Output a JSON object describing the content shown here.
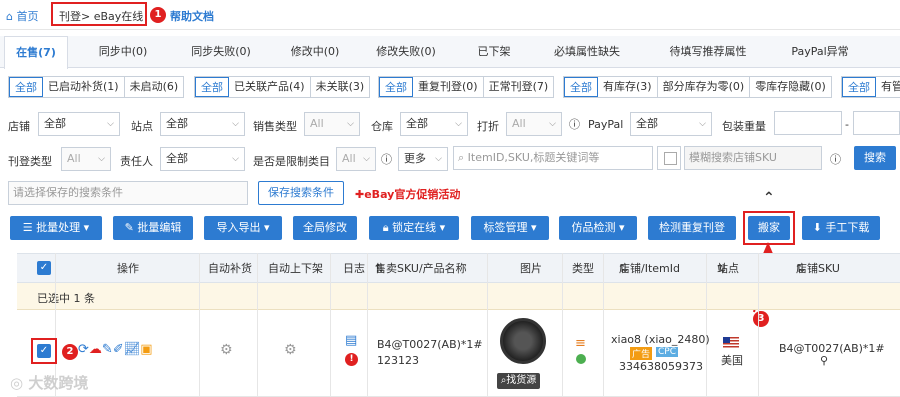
{
  "breadcrumb": {
    "home": "首页",
    "crumb": "刊登> eBay在线",
    "doc": "帮助文档",
    "badge": "1"
  },
  "tabs": [
    "在售(7)",
    "同步中(0)",
    "同步失败(0)",
    "修改中(0)",
    "修改失败(0)",
    "已下架",
    "必填属性缺失",
    "待填写推荐属性",
    "PayPal异常"
  ],
  "filters": {
    "group1": [
      "全部",
      "已启动补货(1)",
      "未启动(6)"
    ],
    "group2": [
      "全部",
      "已关联产品(4)",
      "未关联(3)"
    ],
    "group3": [
      "全部",
      "重复刊登(0)",
      "正常刊登(7)"
    ],
    "group4": [
      "全部",
      "有库存(3)",
      "部分库存为零(0)",
      "零库存隐藏(0)"
    ],
    "group5": [
      "全部",
      "有管"
    ]
  },
  "search": {
    "store_label": "店铺",
    "store_value": "全部",
    "site_label": "站点",
    "site_value": "全部",
    "saletype_label": "销售类型",
    "saletype_value": "All",
    "warehouse_label": "仓库",
    "warehouse_value": "全部",
    "discount_label": "打折",
    "discount_value": "All",
    "paypal_label": "PayPal",
    "paypal_value": "全部",
    "weight_label": "包装重量",
    "dash": "-",
    "listtype_label": "刊登类型",
    "listtype_value": "All",
    "owner_label": "责任人",
    "owner_value": "全部",
    "limited_label": "是否是限制类目",
    "limited_value": "All",
    "more_value": "更多",
    "keyword_placeholder": "ItemID,SKU,标题关键词等",
    "fuzzy_placeholder": "模糊搜索店铺SKU",
    "search_btn": "搜索",
    "saved_placeholder": "请选择保存的搜索条件",
    "save_btn": "保存搜索条件",
    "promo": "eBay官方促销活动"
  },
  "toolbar": [
    "批量处理",
    "批量编辑",
    "导入导出",
    "全局修改",
    "锁定在线",
    "标签管理",
    "仿品检测",
    "检测重复刊登",
    "搬家",
    "手工下载"
  ],
  "badges": {
    "b2": "2",
    "b3": "3"
  },
  "table": {
    "headers": [
      "操作",
      "自动补货",
      "自动上下架",
      "日志",
      "售卖SKU/产品名称",
      "图片",
      "类型",
      "店铺/ItemId",
      "站点",
      "店铺SKU"
    ],
    "selected": "已选中 1 条",
    "row": {
      "sku": "B4@T0027(AB)*1#",
      "name": "123123",
      "store": "xiao8",
      "account": "(xiao_2480)",
      "ad": "广告",
      "cpc": "CPC",
      "itemid": "334638059373",
      "site": "美国",
      "store_sku": "B4@T0027(AB)*1#",
      "find": "找货源"
    }
  },
  "watermark": "大数跨境"
}
